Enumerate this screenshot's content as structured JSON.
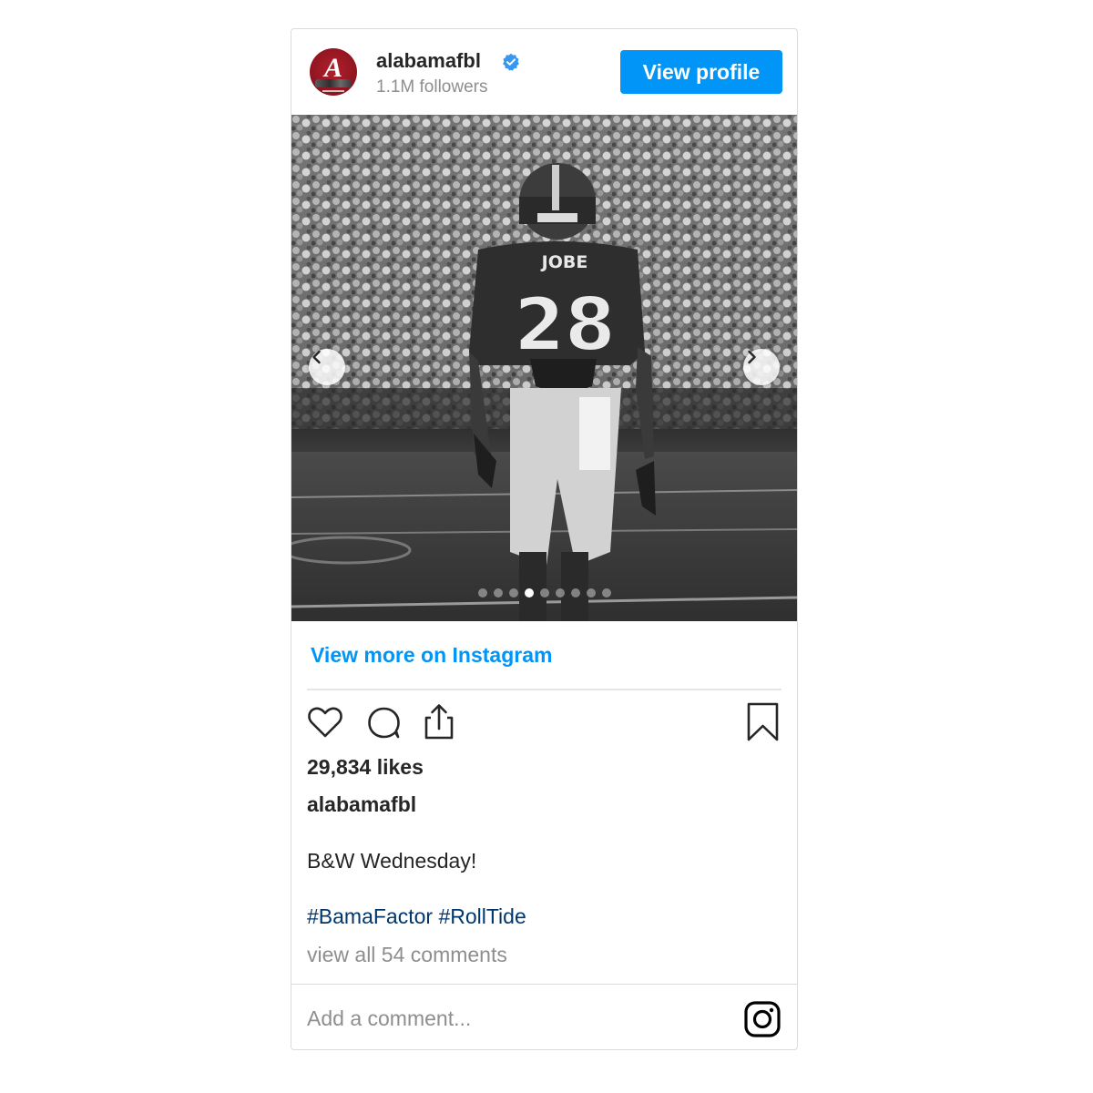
{
  "header": {
    "username": "alabamafbl",
    "followers": "1.1M followers",
    "view_profile_label": "View profile",
    "verified_icon": "verified-badge-icon",
    "accent_color": "#0095f6"
  },
  "photo": {
    "description_icon": "football-player-photo",
    "jersey_name": "JOBE",
    "jersey_number": "28",
    "carousel_dots": 9,
    "active_dot": 4
  },
  "links": {
    "view_more": "View more on Instagram"
  },
  "post": {
    "likes": "29,834 likes",
    "caption_user": "alabamafbl",
    "caption": "B&W Wednesday!",
    "hashtags": "#BamaFactor #RollTide",
    "view_comments": "view all 54 comments",
    "add_comment_placeholder": "Add a comment..."
  },
  "icons": [
    "heart-icon",
    "comment-icon",
    "share-icon",
    "bookmark-icon",
    "instagram-icon",
    "chevron-left-icon",
    "chevron-right-icon"
  ]
}
